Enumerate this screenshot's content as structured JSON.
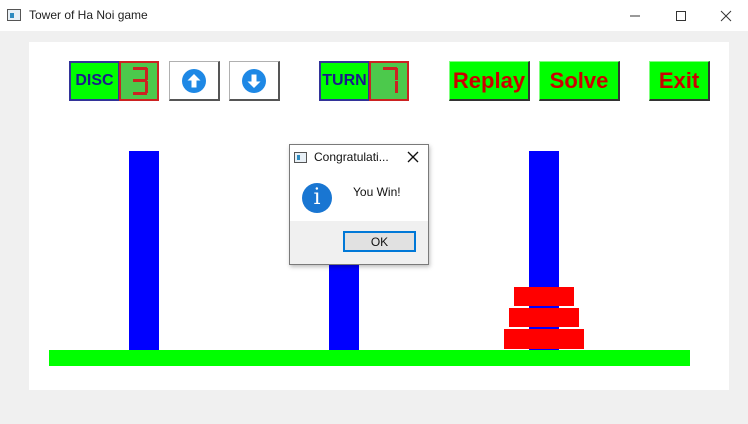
{
  "window": {
    "title": "Tower of Ha Noi game",
    "controls": [
      "minimize",
      "maximize",
      "close"
    ]
  },
  "toolbar": {
    "disc_label": "DISC",
    "disc_count": "3",
    "turn_label": "TURN",
    "turn_count": "7",
    "increase_icon": "arrow-up-circle-icon",
    "decrease_icon": "arrow-down-circle-icon",
    "replay_label": "Replay",
    "solve_label": "Solve",
    "exit_label": "Exit"
  },
  "game": {
    "pegs": 3,
    "discs_on_peg_3": 3
  },
  "dialog": {
    "title": "Congratulati...",
    "message": "You Win!",
    "ok_label": "OK",
    "icon": "info-icon"
  },
  "colors": {
    "lcd_background": "#4cc94c",
    "lcd_segment": "#cc2222",
    "button_green": "#00ff00",
    "button_text": "#cc0000",
    "label_text": "#1a1a8c",
    "peg": "#0000ff",
    "base": "#00ff00",
    "disc": "#ff0000",
    "info_blue": "#1976d2"
  }
}
